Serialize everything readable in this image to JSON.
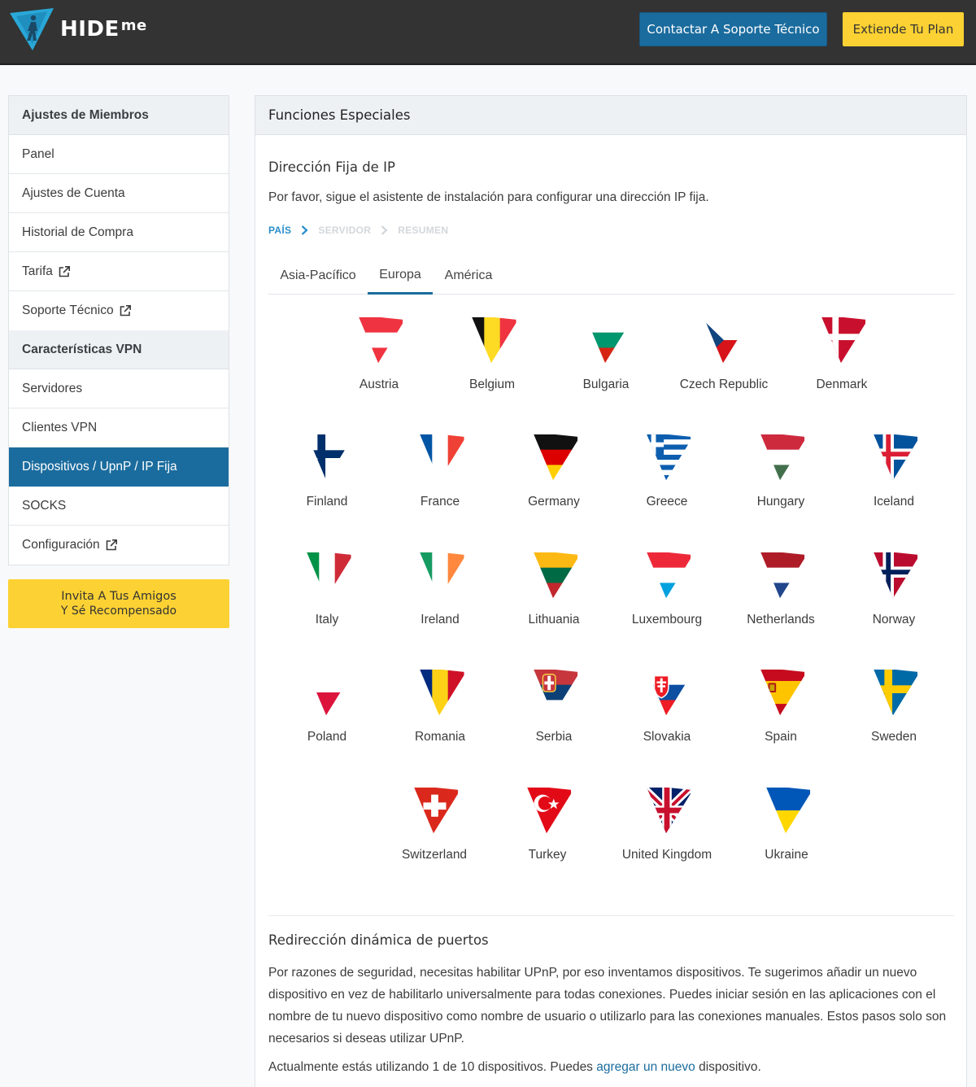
{
  "header": {
    "brand": "HIDE",
    "brand_suffix": "me",
    "support_button": "Contactar A Soporte Técnico",
    "extend_button": "Extiende Tu Plan"
  },
  "sidebar": {
    "section1_title": "Ajustes de Miembros",
    "section1_items": [
      {
        "label": "Panel",
        "external": false
      },
      {
        "label": "Ajustes de Cuenta",
        "external": false
      },
      {
        "label": "Historial de Compra",
        "external": false
      },
      {
        "label": "Tarifa",
        "external": true
      },
      {
        "label": "Soporte Técnico",
        "external": true
      }
    ],
    "section2_title": "Características VPN",
    "section2_items": [
      {
        "label": "Servidores",
        "external": false
      },
      {
        "label": "Clientes VPN",
        "external": false
      },
      {
        "label": "Dispositivos / UpnP / IP Fija",
        "external": false,
        "active": true
      },
      {
        "label": "SOCKS",
        "external": false
      },
      {
        "label": "Configuración",
        "external": true
      }
    ],
    "invite_line1": "Invita A Tus Amigos",
    "invite_line2": "Y Sé Recompensado"
  },
  "main": {
    "panel_title": "Funciones Especiales",
    "fixed_ip": {
      "title": "Dirección Fija de IP",
      "description": "Por favor, sigue el asistente de instalación para configurar una dirección IP fija.",
      "steps": [
        "PAÍS",
        "SERVIDOR",
        "RESUMEN"
      ],
      "active_step": 0
    },
    "tabs": [
      {
        "label": "Asia-Pacífico",
        "active": false
      },
      {
        "label": "Europa",
        "active": true
      },
      {
        "label": "América",
        "active": false
      }
    ],
    "countries": [
      {
        "name": "Austria",
        "flag": "austria"
      },
      {
        "name": "Belgium",
        "flag": "belgium"
      },
      {
        "name": "Bulgaria",
        "flag": "bulgaria"
      },
      {
        "name": "Czech Republic",
        "flag": "czech"
      },
      {
        "name": "Denmark",
        "flag": "denmark"
      },
      {
        "name": "Finland",
        "flag": "finland"
      },
      {
        "name": "France",
        "flag": "france"
      },
      {
        "name": "Germany",
        "flag": "germany"
      },
      {
        "name": "Greece",
        "flag": "greece"
      },
      {
        "name": "Hungary",
        "flag": "hungary"
      },
      {
        "name": "Iceland",
        "flag": "iceland"
      },
      {
        "name": "Italy",
        "flag": "italy"
      },
      {
        "name": "Ireland",
        "flag": "ireland"
      },
      {
        "name": "Lithuania",
        "flag": "lithuania"
      },
      {
        "name": "Luxembourg",
        "flag": "luxembourg"
      },
      {
        "name": "Netherlands",
        "flag": "netherlands"
      },
      {
        "name": "Norway",
        "flag": "norway"
      },
      {
        "name": "Poland",
        "flag": "poland"
      },
      {
        "name": "Romania",
        "flag": "romania"
      },
      {
        "name": "Serbia",
        "flag": "serbia"
      },
      {
        "name": "Slovakia",
        "flag": "slovakia"
      },
      {
        "name": "Spain",
        "flag": "spain"
      },
      {
        "name": "Sweden",
        "flag": "sweden"
      },
      {
        "name": "Switzerland",
        "flag": "switzerland"
      },
      {
        "name": "Turkey",
        "flag": "turkey"
      },
      {
        "name": "United Kingdom",
        "flag": "uk"
      },
      {
        "name": "Ukraine",
        "flag": "ukraine"
      }
    ],
    "port_forwarding": {
      "title": "Redirección dinámica de puertos",
      "paragraph": "Por razones de seguridad, necesitas habilitar UPnP, por eso inventamos dispositivos. Te sugerimos añadir un nuevo dispositivo en vez de habilitarlo universalmente para todas conexiones. Puedes iniciar sesión en las aplicaciones con el nombre de tu nuevo dispositivo como nombre de usuario o utilizarlo para las conexiones manuales. Estos pasos solo son necesarios si deseas utilizar UPnP.",
      "usage_prefix": "Actualmente estás utilizando 1 de 10 dispositivos. Puedes ",
      "usage_link": "agregar un nuevo",
      "usage_suffix": " dispositivo."
    }
  },
  "colors": {
    "header_bg": "#333333",
    "primary_blue": "#1b6c9e",
    "accent_yellow": "#fcd133",
    "step_active": "#2a8ec9"
  }
}
